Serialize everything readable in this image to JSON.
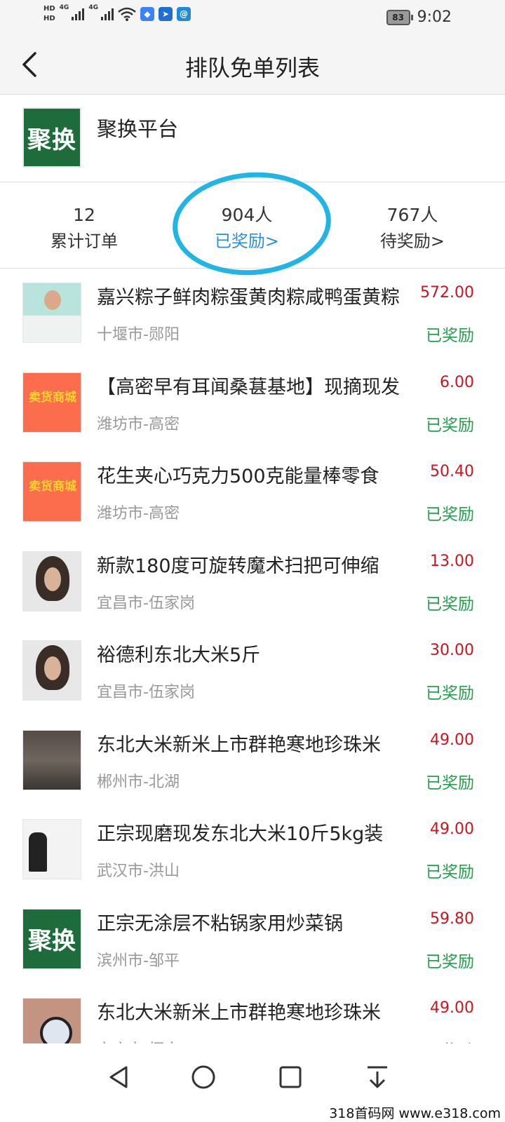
{
  "status_bar": {
    "network_labels": [
      "HD",
      "HD",
      "4G",
      "4G"
    ],
    "app_icons": [
      "dropbox-icon",
      "telegram-icon",
      "at-sign-icon"
    ],
    "battery": "83",
    "time": "9:02"
  },
  "header": {
    "title": "排队免单列表",
    "back_icon": "chevron-left-icon"
  },
  "platform": {
    "logo_text": "聚换",
    "name": "聚换平台"
  },
  "stats": [
    {
      "value": "12",
      "label": "累计订单"
    },
    {
      "value": "904人",
      "label": "已奖励>"
    },
    {
      "value": "767人",
      "label": "待奖励>"
    }
  ],
  "colors": {
    "price": "#c9151e",
    "status": "#21a24a",
    "link": "#2f8ecf",
    "annotation": "#21b5e5",
    "brand": "#1e6b3c"
  },
  "items": [
    {
      "title": "嘉兴粽子鲜肉粽蛋黄肉粽咸鸭蛋黄粽",
      "location": "十堰市-郧阳",
      "price": "572.00",
      "status": "已奖励"
    },
    {
      "title": "【高密早有耳闻桑葚基地】现摘现发",
      "location": "潍坊市-高密",
      "price": "6.00",
      "status": "已奖励"
    },
    {
      "title": "花生夹心巧克力500克能量棒零食",
      "location": "潍坊市-高密",
      "price": "50.40",
      "status": "已奖励"
    },
    {
      "title": "新款180度可旋转魔术扫把可伸缩",
      "location": "宜昌市-伍家岗",
      "price": "13.00",
      "status": "已奖励"
    },
    {
      "title": "裕德利东北大米5斤",
      "location": "宜昌市-伍家岗",
      "price": "30.00",
      "status": "已奖励"
    },
    {
      "title": "东北大米新米上市群艳寒地珍珠米",
      "location": "郴州市-北湖",
      "price": "49.00",
      "status": "已奖励"
    },
    {
      "title": "正宗现磨现发东北大米10斤5kg装",
      "location": "武汉市-洪山",
      "price": "49.00",
      "status": "已奖励"
    },
    {
      "title": "正宗无涂层不粘锅家用炒菜锅",
      "location": "滨州市-邹平",
      "price": "59.80",
      "status": "已奖励"
    },
    {
      "title": "东北大米新米上市群艳寒地珍珠米",
      "location": "安庆市-怀宁",
      "price": "49.00",
      "status": "已奖励"
    }
  ],
  "thumb_texts": {
    "shop": "卖货商城",
    "logo": "聚换"
  },
  "watermark": "318首码网 www.e318.com"
}
